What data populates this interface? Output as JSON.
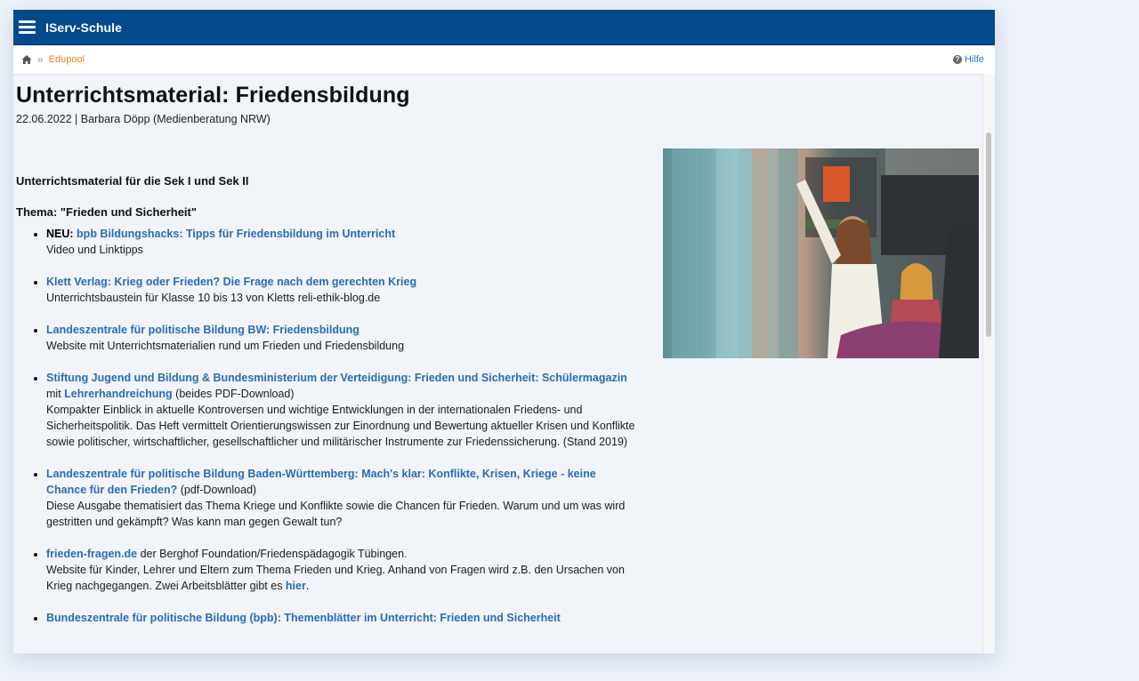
{
  "app": {
    "title": "IServ-Schule"
  },
  "breadcrumb": {
    "separator": "»",
    "current": "Edupool"
  },
  "help": {
    "icon_text": "?",
    "label": "Hilfe"
  },
  "article": {
    "title": "Unterrichtsmaterial: Friedensbildung",
    "meta": "22.06.2022 | Barbara Döpp (Medienberatung NRW)",
    "subtitle": "Unterrichtsmaterial für die Sek I und Sek II",
    "topic": "Thema: \"Frieden und Sicherheit\"",
    "items": [
      {
        "prefix": "NEU:",
        "link": "bpb Bildungshacks: Tipps für Friedensbildung im Unterricht",
        "desc": "Video und Linktipps"
      },
      {
        "link": "Klett Verlag: Krieg oder Frieden? Die Frage nach dem gerechten Krieg",
        "desc": "Unterrichtsbaustein für Klasse 10 bis 13 von Kletts reli-ethik-blog.de"
      },
      {
        "link": "Landeszentrale für politische Bildung BW: Friedensbildung",
        "desc": "Website mit Unterrichtsmaterialien rund um Frieden und Friedensbildung"
      },
      {
        "link": "Stiftung Jugend und Bildung & Bundesministerium der Verteidigung: Frieden und Sicherheit: Schülermagazin",
        "mid": " mit ",
        "link2": "Lehrerhandreichung",
        "after": " (beides PDF-Download)",
        "desc": "Kompakter Einblick in aktuelle Kontroversen und wichtige Entwicklungen in der internationalen Friedens- und Sicherheitspolitik. Das Heft vermittelt Orientierungswissen zur Einordnung und Bewertung aktueller Krisen und Konflikte sowie politischer, wirtschaftlicher, gesellschaftlicher und militärischer Instrumente zur Friedenssicherung. (Stand 2019)"
      },
      {
        "link": "Landeszentrale für politische Bildung Baden-Württemberg: Mach's klar: Konflikte, Krisen, Kriege - keine Chance für den Frieden?",
        "after": " (pdf-Download)",
        "desc": "Diese Ausgabe thematisiert das Thema Kriege und Konflikte sowie die Chancen für Frieden. Warum und um was wird gestritten und gekämpft? Was kann man gegen Gewalt tun?"
      },
      {
        "link": "frieden-fragen.de",
        "after": " der Berghof Foundation/Friedenspädagogik Tübingen.",
        "desc": "Website für Kinder, Lehrer und Eltern zum Thema Frieden und Krieg. Anhand von Fragen wird z.B. den Ursachen von Krieg nachgegangen. Zwei Arbeitsblätter gibt es ",
        "desc_link": "hier",
        "desc_end": "."
      },
      {
        "link": "Bundeszentrale für politische Bildung (bpb): Themenblätter im Unterricht: Frieden und Sicherheit",
        "desc": ""
      }
    ]
  },
  "colors": {
    "topbar": "#034a8d",
    "link": "#2b6cb0",
    "breadcrumb": "#e8841a",
    "page_bg": "#f1f4f8"
  },
  "icons": {
    "menu": "hamburger-icon",
    "home": "home-icon",
    "help": "question-circle-icon"
  }
}
